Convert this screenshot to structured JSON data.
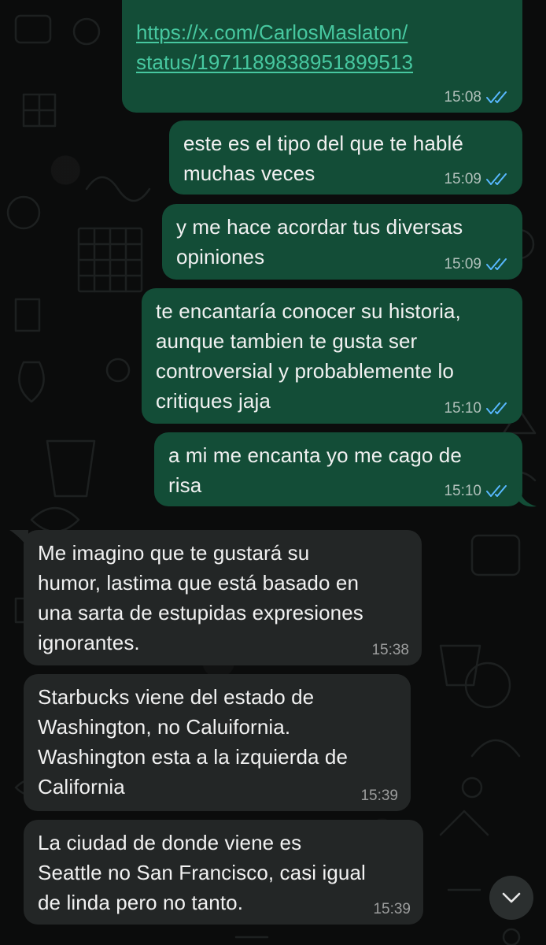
{
  "messages": [
    {
      "direction": "out",
      "text": "https://x.com/CarlosMaslaton/\nstatus/1971189838951899513",
      "is_link": true,
      "time": "15:08",
      "status": "read"
    },
    {
      "direction": "out",
      "text": "este es el tipo del que te hablé\nmuchas veces",
      "time": "15:09",
      "status": "read"
    },
    {
      "direction": "out",
      "text": "y me hace acordar tus diversas\nopiniones",
      "time": "15:09",
      "status": "read"
    },
    {
      "direction": "out",
      "text": "te encantaría conocer su historia,\naunque tambien te gusta ser\ncontroversial y probablemente lo\ncritiques jaja",
      "time": "15:10",
      "status": "read"
    },
    {
      "direction": "out",
      "text": "a mi me encanta yo me cago de\nrisa",
      "time": "15:10",
      "status": "read"
    },
    {
      "direction": "in",
      "text": "Me imagino que te gustará su\nhumor, lastima que está basado en\nuna sarta de estupidas expresiones\nignorantes.",
      "time": "15:38"
    },
    {
      "direction": "in",
      "text": "Starbucks viene del estado de\nWashington, no Caluifornia.\nWashington esta a la izquierda de\nCalifornia",
      "time": "15:39"
    },
    {
      "direction": "in",
      "text": "La ciudad de donde viene es\nSeattle no San Francisco, casi igual\nde linda pero no tanto.",
      "time": "15:39"
    }
  ],
  "scroll_button": {
    "icon": "chevron-down-icon"
  },
  "colors": {
    "outgoing_bubble": "#134d37",
    "incoming_bubble": "#232626",
    "link": "#47c8a0",
    "read_ticks": "#58b8ff",
    "background": "#0b0c0c"
  }
}
